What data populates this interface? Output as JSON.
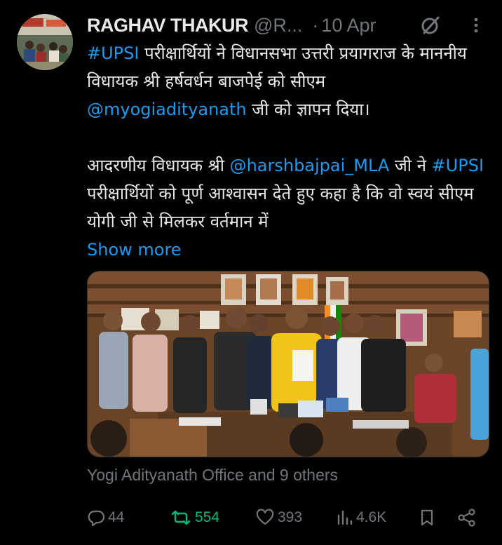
{
  "tweet": {
    "display_name": "RAGHAV THAKUR",
    "handle": "@R...",
    "separator": "·",
    "date": "10 Apr",
    "text": {
      "line1_tag": "#UPSI",
      "line1_rest": " परीक्षार्थियों ने विधानसभा उत्तरी प्रयागराज के माननीय विधायक श्री हर्षवर्धन बाजपेई को सीएम ",
      "mention_cm": "@myogiadityanath",
      "line1_end": " जी को ज्ञापन दिया।",
      "para2_start": "आदरणीय विधायक श्री ",
      "mention_mla": "@harshbajpai_MLA",
      "para2_mid": " जी ने ",
      "para2_tag": "#UPSI",
      "para2_rest": " परीक्षार्थियों को पूर्ण आश्वासन देते हुए कहा है कि वो स्वयं सीएम योगी जी से मिलकर वर्तमान में"
    },
    "show_more": "Show more",
    "tagged_people": "Yogi Adityanath Office and 9 others"
  },
  "actions": {
    "replies": "44",
    "retweets": "554",
    "likes": "393",
    "views": "4.6K"
  },
  "colors": {
    "background": "#000000",
    "text": "#e7e9ea",
    "muted": "#71767b",
    "link": "#1d9bf0",
    "retweet_active": "#00ba7c"
  }
}
